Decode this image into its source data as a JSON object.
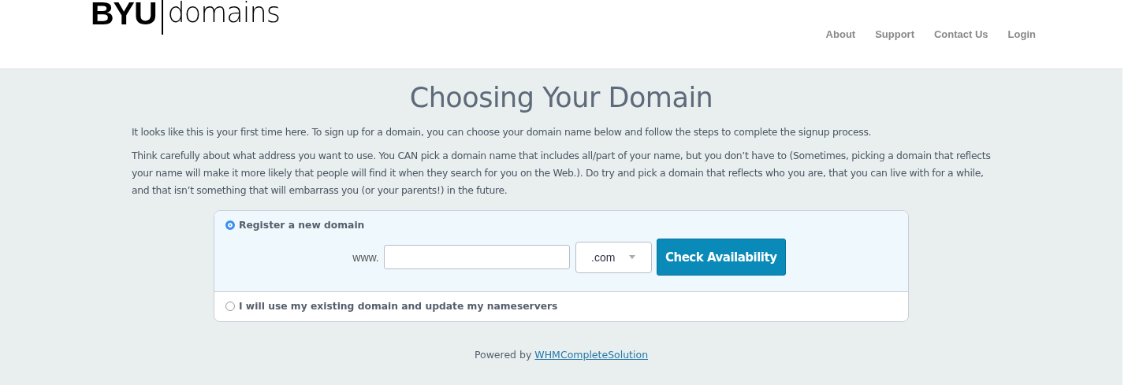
{
  "header": {
    "logo": {
      "primary": "BYU",
      "secondary": "domains"
    },
    "nav": [
      {
        "label": "About"
      },
      {
        "label": "Support"
      },
      {
        "label": "Contact Us"
      },
      {
        "label": "Login"
      }
    ]
  },
  "title": "Choosing Your Domain",
  "paragraphs": [
    "It looks like this is your first time here. To sign up for a domain, you can choose your domain name below and follow the steps to complete the signup process.",
    "Think carefully about what address you want to use. You CAN pick a domain name that includes all/part of your name, but you don’t have to (Sometimes, picking a domain that reflects your name will make it more likely that people will find it when they search for you on the Web.). Do try and pick a domain that reflects who you are, that you can live with for a while, and that isn’t something that will embarrass you (or your parents!) in the future."
  ],
  "options": [
    {
      "label": "Register a new domain",
      "selected": true,
      "prefix": "www.",
      "tld": ".com",
      "button": "Check Availability"
    },
    {
      "label": "I will use my existing domain and update my nameservers",
      "selected": false
    }
  ],
  "footer": {
    "text": "Powered by",
    "link": "WHMCompleteSolution"
  }
}
